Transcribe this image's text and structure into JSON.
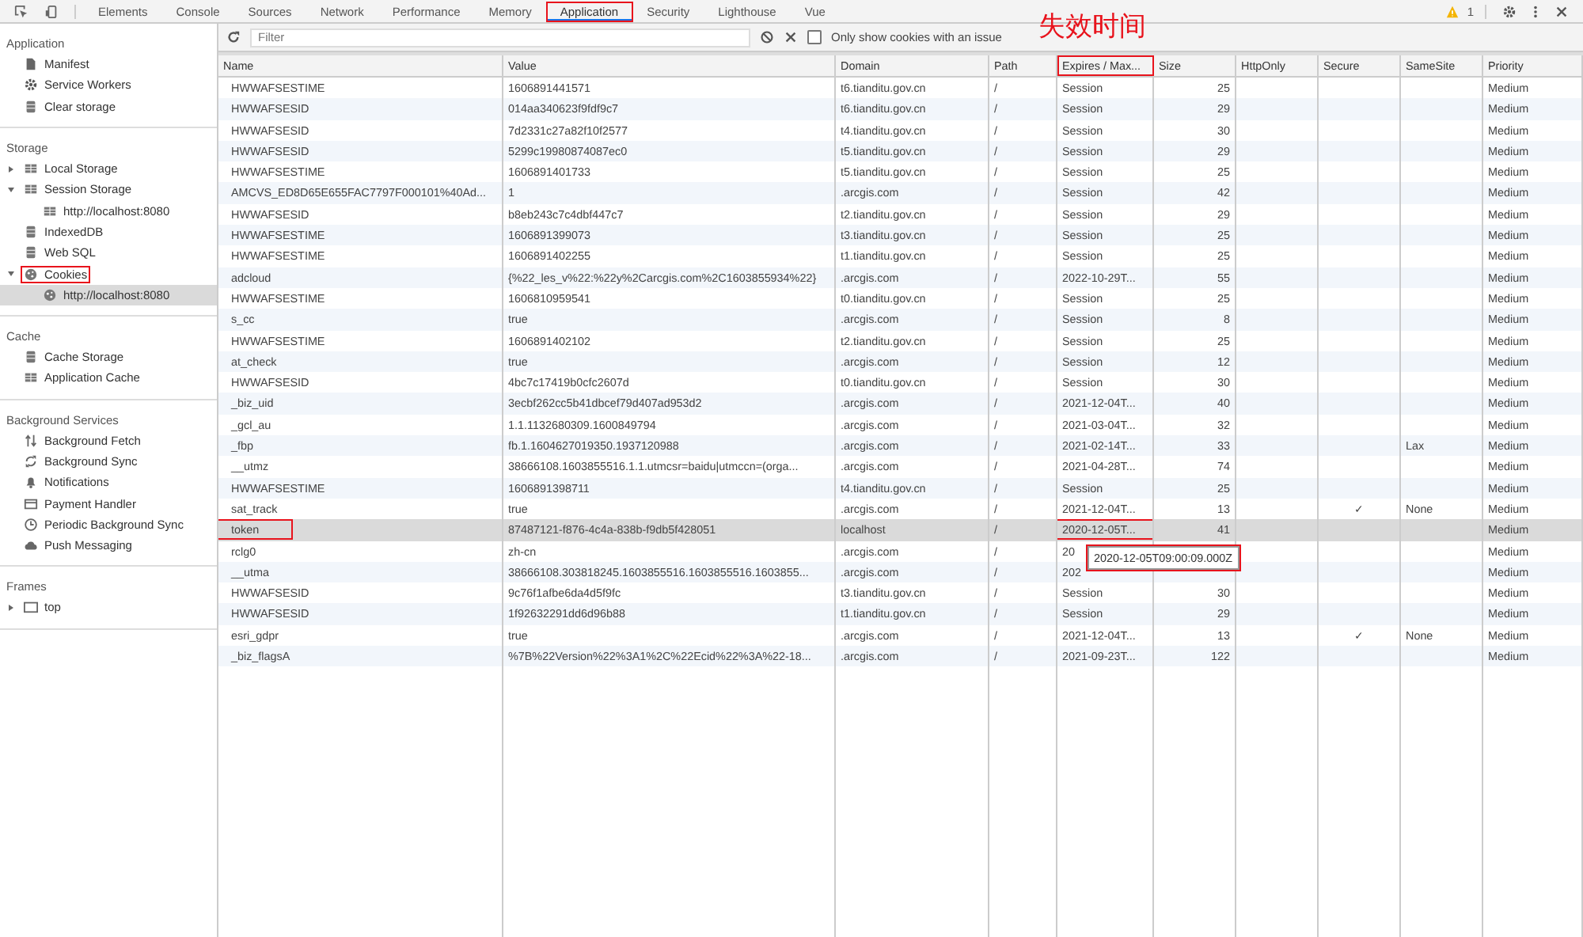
{
  "tabs": [
    {
      "label": "Elements",
      "selected": false,
      "boxed": false
    },
    {
      "label": "Console",
      "selected": false,
      "boxed": false
    },
    {
      "label": "Sources",
      "selected": false,
      "boxed": false
    },
    {
      "label": "Network",
      "selected": false,
      "boxed": false
    },
    {
      "label": "Performance",
      "selected": false,
      "boxed": false
    },
    {
      "label": "Memory",
      "selected": false,
      "boxed": false
    },
    {
      "label": "Application",
      "selected": true,
      "boxed": true
    },
    {
      "label": "Security",
      "selected": false,
      "boxed": false
    },
    {
      "label": "Lighthouse",
      "selected": false,
      "boxed": false
    },
    {
      "label": "Vue",
      "selected": false,
      "boxed": false
    }
  ],
  "warnings": {
    "count": "1"
  },
  "annotation": {
    "text": "失效时间"
  },
  "sidebar": {
    "sections": [
      {
        "title": "Application",
        "items": [
          {
            "label": "Manifest",
            "selected": false,
            "boxed": false
          },
          {
            "label": "Service Workers",
            "selected": false,
            "boxed": false
          },
          {
            "label": "Clear storage",
            "selected": false,
            "boxed": false
          }
        ]
      },
      {
        "title": "Storage",
        "items": [
          {
            "label": "Local Storage",
            "selected": false,
            "boxed": false,
            "expanded": false
          },
          {
            "label": "Session Storage",
            "selected": false,
            "boxed": false,
            "expanded": true,
            "children": [
              {
                "label": "http://localhost:8080",
                "selected": false,
                "boxed": false
              }
            ]
          },
          {
            "label": "IndexedDB",
            "selected": false,
            "boxed": false
          },
          {
            "label": "Web SQL",
            "selected": false,
            "boxed": false
          },
          {
            "label": "Cookies",
            "selected": false,
            "boxed": true,
            "expanded": true,
            "children": [
              {
                "label": "http://localhost:8080",
                "selected": true,
                "boxed": false
              }
            ]
          }
        ]
      },
      {
        "title": "Cache",
        "items": [
          {
            "label": "Cache Storage",
            "selected": false,
            "boxed": false
          },
          {
            "label": "Application Cache",
            "selected": false,
            "boxed": false
          }
        ]
      },
      {
        "title": "Background Services",
        "items": [
          {
            "label": "Background Fetch",
            "selected": false,
            "boxed": false
          },
          {
            "label": "Background Sync",
            "selected": false,
            "boxed": false
          },
          {
            "label": "Notifications",
            "selected": false,
            "boxed": false
          },
          {
            "label": "Payment Handler",
            "selected": false,
            "boxed": false
          },
          {
            "label": "Periodic Background Sync",
            "selected": false,
            "boxed": false
          },
          {
            "label": "Push Messaging",
            "selected": false,
            "boxed": false
          }
        ]
      },
      {
        "title": "Frames",
        "items": [
          {
            "label": "top",
            "selected": false,
            "boxed": false,
            "expanded": false
          }
        ]
      }
    ]
  },
  "toolbar": {
    "filter_placeholder": "Filter",
    "issue_checkbox": {
      "label": "Only show cookies with an issue",
      "checked": false
    }
  },
  "table": {
    "columns": [
      {
        "label": "Name",
        "boxed": false
      },
      {
        "label": "Value",
        "boxed": false
      },
      {
        "label": "Domain",
        "boxed": false
      },
      {
        "label": "Path",
        "boxed": false
      },
      {
        "label": "Expires / Max...",
        "boxed": true
      },
      {
        "label": "Size",
        "boxed": false
      },
      {
        "label": "HttpOnly",
        "boxed": false
      },
      {
        "label": "Secure",
        "boxed": false
      },
      {
        "label": "SameSite",
        "boxed": false
      },
      {
        "label": "Priority",
        "boxed": false
      }
    ],
    "rows": [
      {
        "name": "HWWAFSESTIME",
        "value": "1606891441571",
        "domain": "t6.tianditu.gov.cn",
        "path": "/",
        "expires": "Session",
        "size": "25",
        "priority": "Medium",
        "selected": false
      },
      {
        "name": "HWWAFSESID",
        "value": "014aa340623f9fdf9c7",
        "domain": "t6.tianditu.gov.cn",
        "path": "/",
        "expires": "Session",
        "size": "29",
        "priority": "Medium",
        "selected": false
      },
      {
        "name": "HWWAFSESID",
        "value": "7d2331c27a82f10f2577",
        "domain": "t4.tianditu.gov.cn",
        "path": "/",
        "expires": "Session",
        "size": "30",
        "priority": "Medium",
        "selected": false
      },
      {
        "name": "HWWAFSESID",
        "value": "5299c19980874087ec0",
        "domain": "t5.tianditu.gov.cn",
        "path": "/",
        "expires": "Session",
        "size": "29",
        "priority": "Medium",
        "selected": false
      },
      {
        "name": "HWWAFSESTIME",
        "value": "1606891401733",
        "domain": "t5.tianditu.gov.cn",
        "path": "/",
        "expires": "Session",
        "size": "25",
        "priority": "Medium",
        "selected": false
      },
      {
        "name": "AMCVS_ED8D65E655FAC7797F000101%40Ad...",
        "value": "1",
        "domain": ".arcgis.com",
        "path": "/",
        "expires": "Session",
        "size": "42",
        "priority": "Medium",
        "selected": false
      },
      {
        "name": "HWWAFSESID",
        "value": "b8eb243c7c4dbf447c7",
        "domain": "t2.tianditu.gov.cn",
        "path": "/",
        "expires": "Session",
        "size": "29",
        "priority": "Medium",
        "selected": false
      },
      {
        "name": "HWWAFSESTIME",
        "value": "1606891399073",
        "domain": "t3.tianditu.gov.cn",
        "path": "/",
        "expires": "Session",
        "size": "25",
        "priority": "Medium",
        "selected": false
      },
      {
        "name": "HWWAFSESTIME",
        "value": "1606891402255",
        "domain": "t1.tianditu.gov.cn",
        "path": "/",
        "expires": "Session",
        "size": "25",
        "priority": "Medium",
        "selected": false
      },
      {
        "name": "adcloud",
        "value": "{%22_les_v%22:%22y%2Carcgis.com%2C1603855934%22}",
        "domain": ".arcgis.com",
        "path": "/",
        "expires": "2022-10-29T...",
        "size": "55",
        "priority": "Medium",
        "selected": false
      },
      {
        "name": "HWWAFSESTIME",
        "value": "1606810959541",
        "domain": "t0.tianditu.gov.cn",
        "path": "/",
        "expires": "Session",
        "size": "25",
        "priority": "Medium",
        "selected": false
      },
      {
        "name": "s_cc",
        "value": "true",
        "domain": ".arcgis.com",
        "path": "/",
        "expires": "Session",
        "size": "8",
        "priority": "Medium",
        "selected": false
      },
      {
        "name": "HWWAFSESTIME",
        "value": "1606891402102",
        "domain": "t2.tianditu.gov.cn",
        "path": "/",
        "expires": "Session",
        "size": "25",
        "priority": "Medium",
        "selected": false
      },
      {
        "name": "at_check",
        "value": "true",
        "domain": ".arcgis.com",
        "path": "/",
        "expires": "Session",
        "size": "12",
        "priority": "Medium",
        "selected": false
      },
      {
        "name": "HWWAFSESID",
        "value": "4bc7c17419b0cfc2607d",
        "domain": "t0.tianditu.gov.cn",
        "path": "/",
        "expires": "Session",
        "size": "30",
        "priority": "Medium",
        "selected": false
      },
      {
        "name": "_biz_uid",
        "value": "3ecbf262cc5b41dbcef79d407ad953d2",
        "domain": ".arcgis.com",
        "path": "/",
        "expires": "2021-12-04T...",
        "size": "40",
        "priority": "Medium",
        "selected": false
      },
      {
        "name": "_gcl_au",
        "value": "1.1.1132680309.1600849794",
        "domain": ".arcgis.com",
        "path": "/",
        "expires": "2021-03-04T...",
        "size": "32",
        "priority": "Medium",
        "selected": false
      },
      {
        "name": "_fbp",
        "value": "fb.1.1604627019350.1937120988",
        "domain": ".arcgis.com",
        "path": "/",
        "expires": "2021-02-14T...",
        "size": "33",
        "samesite": "Lax",
        "priority": "Medium",
        "selected": false
      },
      {
        "name": "__utmz",
        "value": "38666108.1603855516.1.1.utmcsr=baidu|utmccn=(orga...",
        "domain": ".arcgis.com",
        "path": "/",
        "expires": "2021-04-28T...",
        "size": "74",
        "priority": "Medium",
        "selected": false
      },
      {
        "name": "HWWAFSESTIME",
        "value": "1606891398711",
        "domain": "t4.tianditu.gov.cn",
        "path": "/",
        "expires": "Session",
        "size": "25",
        "priority": "Medium",
        "selected": false
      },
      {
        "name": "sat_track",
        "value": "true",
        "domain": ".arcgis.com",
        "path": "/",
        "expires": "2021-12-04T...",
        "size": "13",
        "secure": "✓",
        "samesite": "None",
        "priority": "Medium",
        "selected": false
      },
      {
        "name": "token",
        "value": "87487121-f876-4c4a-838b-f9db5f428051",
        "domain": "localhost",
        "path": "/",
        "expires": "2020-12-05T...",
        "size": "41",
        "priority": "Medium",
        "selected": true,
        "name_boxed": true,
        "expires_boxed": true
      },
      {
        "name": "rclg0",
        "value": "zh-cn",
        "domain": ".arcgis.com",
        "path": "/",
        "expires": "20",
        "priority": "Medium",
        "selected": false
      },
      {
        "name": "__utma",
        "value": "38666108.303818245.1603855516.1603855516.1603855...",
        "domain": ".arcgis.com",
        "path": "/",
        "expires": "202",
        "priority": "Medium",
        "selected": false
      },
      {
        "name": "HWWAFSESID",
        "value": "9c76f1afbe6da4d5f9fc",
        "domain": "t3.tianditu.gov.cn",
        "path": "/",
        "expires": "Session",
        "size": "30",
        "priority": "Medium",
        "selected": false
      },
      {
        "name": "HWWAFSESID",
        "value": "1f92632291dd6d96b88",
        "domain": "t1.tianditu.gov.cn",
        "path": "/",
        "expires": "Session",
        "size": "29",
        "priority": "Medium",
        "selected": false
      },
      {
        "name": "esri_gdpr",
        "value": "true",
        "domain": ".arcgis.com",
        "path": "/",
        "expires": "2021-12-04T...",
        "size": "13",
        "secure": "✓",
        "samesite": "None",
        "priority": "Medium",
        "selected": false
      },
      {
        "name": "_biz_flagsA",
        "value": "%7B%22Version%22%3A1%2C%22Ecid%22%3A%22-18...",
        "domain": ".arcgis.com",
        "path": "/",
        "expires": "2021-09-23T...",
        "size": "122",
        "priority": "Medium",
        "selected": false
      }
    ]
  },
  "tooltip": {
    "text": "2020-12-05T09:00:09.000Z",
    "boxed": true
  }
}
